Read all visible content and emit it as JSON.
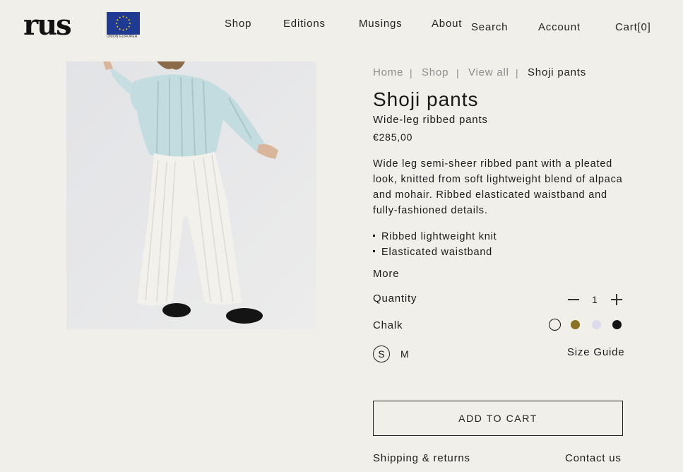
{
  "header": {
    "logo": "rus",
    "eu_caption": "UNIÓN EUROPEA",
    "nav": [
      "Shop",
      "Editions",
      "Musings",
      "About"
    ],
    "search": "Search",
    "account": "Account",
    "cart": "Cart[0]"
  },
  "breadcrumb": [
    "Home",
    "Shop",
    "View all",
    "Shoji pants"
  ],
  "breadcrumb_separator": "|",
  "product": {
    "title": "Shoji pants",
    "subtitle": "Wide-leg ribbed pants",
    "price": "€285,00",
    "description": "Wide leg semi-sheer ribbed pant with a pleated look, knitted from soft lightweight blend of alpaca and mohair. Ribbed elasticated waistband and fully-fashioned details.",
    "features": [
      "Ribbed lightweight knit",
      "Elasticated waistband"
    ],
    "more_label": "More",
    "quantity_label": "Quantity",
    "quantity": "1",
    "color_name": "Chalk",
    "swatches": [
      {
        "name": "chalk",
        "hex": "#f1efea",
        "selected": true
      },
      {
        "name": "olive",
        "hex": "#8a7222",
        "selected": false
      },
      {
        "name": "lilac",
        "hex": "#dcdbec",
        "selected": false
      },
      {
        "name": "black",
        "hex": "#141414",
        "selected": false
      }
    ],
    "sizes": [
      "S",
      "M"
    ],
    "selected_size": "S",
    "size_guide": "Size Guide",
    "add_to_cart": "ADD TO CART",
    "shipping": "Shipping & returns",
    "contact": "Contact us"
  }
}
